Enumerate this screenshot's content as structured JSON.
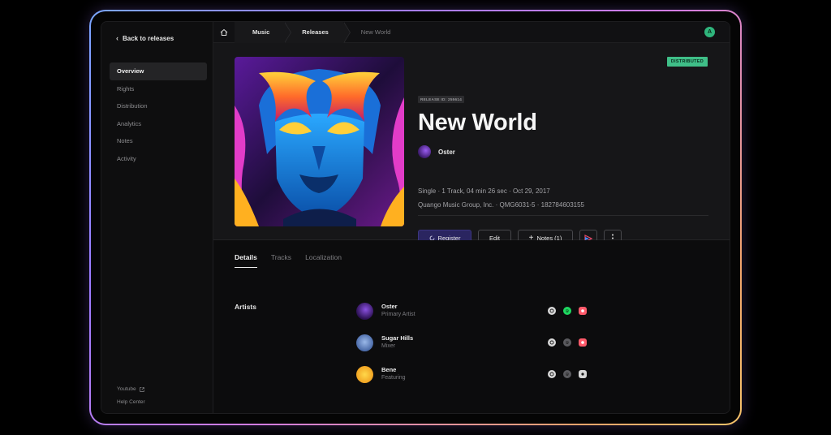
{
  "sidebar": {
    "back_label": "Back to releases",
    "items": [
      {
        "label": "Overview",
        "active": true
      },
      {
        "label": "Rights",
        "active": false
      },
      {
        "label": "Distribution",
        "active": false
      },
      {
        "label": "Analytics",
        "active": false
      },
      {
        "label": "Notes",
        "active": false
      },
      {
        "label": "Activity",
        "active": false
      }
    ],
    "footer": {
      "youtube": "Youtube",
      "help": "Help Center"
    }
  },
  "breadcrumb": {
    "items": [
      "Music",
      "Releases"
    ],
    "current": "New World"
  },
  "user": {
    "initial": "A",
    "color": "#2fb57c"
  },
  "release": {
    "status": "DISTRIBUTED",
    "status_color": "#3fbf88",
    "id_label": "RELEASE ID: 255614",
    "title": "New World",
    "artist": "Oster",
    "meta_line1": "Single · 1 Track, 04 min 26 sec · Oct 29, 2017",
    "meta_line2": "Quango Music Group, Inc. · QMG6031-5 · 182784603155"
  },
  "actions": {
    "register": "Register",
    "edit": "Edit",
    "notes": "Notes (1)"
  },
  "tabs": [
    {
      "label": "Details",
      "active": true
    },
    {
      "label": "Tracks",
      "active": false
    },
    {
      "label": "Localization",
      "active": false
    }
  ],
  "details": {
    "section_label": "Artists",
    "artists": [
      {
        "name": "Oster",
        "role": "Primary Artist",
        "platforms": [
          "apple-music-icon",
          "spotify-icon",
          "apple-podcasts-icon"
        ]
      },
      {
        "name": "Sugar Hills",
        "role": "Mixer",
        "platforms": [
          "apple-music-icon",
          "spotify-icon",
          "apple-podcasts-icon"
        ]
      },
      {
        "name": "Bene",
        "role": "Featuring",
        "platforms": [
          "apple-music-icon",
          "spotify-icon",
          "apple-podcasts-icon"
        ]
      }
    ]
  }
}
